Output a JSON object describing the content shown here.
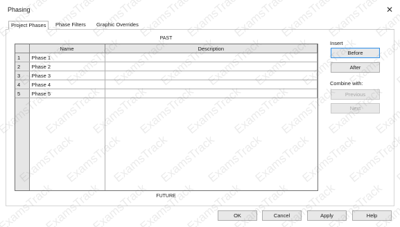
{
  "window": {
    "title": "Phasing"
  },
  "tabs": [
    {
      "label": "Project Phases",
      "active": true
    },
    {
      "label": "Phase Filters",
      "active": false
    },
    {
      "label": "Graphic Overrides",
      "active": false
    }
  ],
  "grid": {
    "top_label": "PAST",
    "bottom_label": "FUTURE",
    "columns": [
      "Name",
      "Description"
    ],
    "rows": [
      {
        "num": "1",
        "name": "Phase 1",
        "description": ""
      },
      {
        "num": "2",
        "name": "Phase 2",
        "description": ""
      },
      {
        "num": "3",
        "name": "Phase 3",
        "description": ""
      },
      {
        "num": "4",
        "name": "Phase 4",
        "description": ""
      },
      {
        "num": "5",
        "name": "Phase 5",
        "description": ""
      }
    ]
  },
  "side": {
    "insert_label": "Insert",
    "before": "Before",
    "after": "After",
    "combine_label": "Combine with:",
    "previous": "Previous",
    "next": "Next"
  },
  "footer": {
    "ok": "OK",
    "cancel": "Cancel",
    "apply": "Apply",
    "help": "Help"
  },
  "watermark": {
    "text": "ExamsTrack"
  },
  "icons": {
    "close": "close-icon"
  },
  "colors": {
    "default_button_border": "#3c8fdc",
    "disabled_text": "#a6a6a6"
  }
}
